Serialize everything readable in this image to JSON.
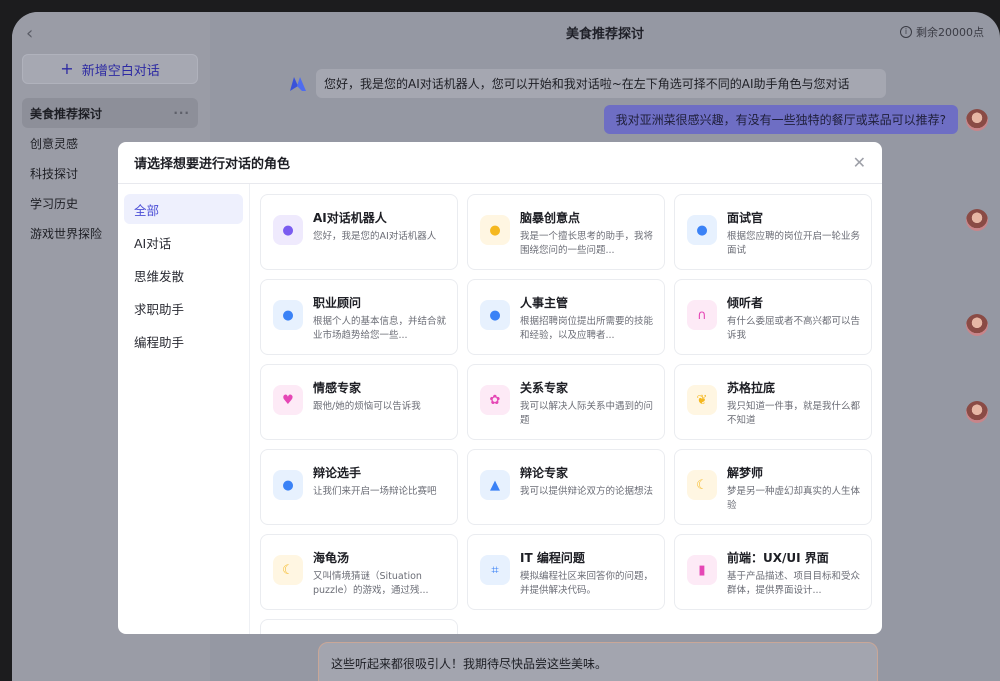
{
  "sidebar": {
    "new_chat_label": "新增空白对话",
    "items": [
      {
        "label": "美食推荐探讨",
        "active": true
      },
      {
        "label": "创意灵感"
      },
      {
        "label": "科技探讨"
      },
      {
        "label": "学习历史"
      },
      {
        "label": "游戏世界探险"
      }
    ]
  },
  "header": {
    "title": "美食推荐探讨",
    "points": "剩余20000点"
  },
  "chat": {
    "bot_message": "您好，我是您的AI对话机器人，您可以开始和我对话啦~在左下角选可择不同的AI助手角色与您对话",
    "user_message": "我对亚洲菜很感兴趣，有没有一些独特的餐厅或菜品可以推荐?",
    "input_text": "这些听起来都很吸引人！我期待尽快品尝这些美味。"
  },
  "modal": {
    "title": "请选择想要进行对话的角色",
    "categories": [
      "全部",
      "AI对话",
      "思维发散",
      "求职助手",
      "编程助手"
    ],
    "roles": [
      {
        "name": "AI对话机器人",
        "desc": "您好，我是您的AI对话机器人",
        "icon": "chat-bot-icon",
        "bg": "#efeafd",
        "fg": "#7a5cf0"
      },
      {
        "name": "脑暴创意点",
        "desc": "我是一个擅长思考的助手，我将围绕您问的一些问题...",
        "icon": "lightbulb-icon",
        "bg": "#fff6e2",
        "fg": "#f5b820"
      },
      {
        "name": "面试官",
        "desc": "根据您应聘的岗位开启一轮业务面试",
        "icon": "interviewer-icon",
        "bg": "#e7f1fe",
        "fg": "#3b82f6"
      },
      {
        "name": "职业顾问",
        "desc": "根据个人的基本信息，并结合就业市场趋势给您一些...",
        "icon": "person-icon",
        "bg": "#e7f1fe",
        "fg": "#3b82f6"
      },
      {
        "name": "人事主管",
        "desc": "根据招聘岗位提出所需要的技能和经验，以及应聘者...",
        "icon": "person-icon",
        "bg": "#e7f1fe",
        "fg": "#3b82f6"
      },
      {
        "name": "倾听者",
        "desc": "有什么委屈或者不高兴都可以告诉我",
        "icon": "headphones-icon",
        "bg": "#fdeaf6",
        "fg": "#e547b5"
      },
      {
        "name": "情感专家",
        "desc": "跟他/她的烦恼可以告诉我",
        "icon": "heart-icon",
        "bg": "#fdeaf6",
        "fg": "#e547b5"
      },
      {
        "name": "关系专家",
        "desc": "我可以解决人际关系中遇到的问题",
        "icon": "handshake-icon",
        "bg": "#fdeaf6",
        "fg": "#e547b5"
      },
      {
        "name": "苏格拉底",
        "desc": "我只知道一件事，就是我什么都不知道",
        "icon": "brain-icon",
        "bg": "#fff6e2",
        "fg": "#f5b820"
      },
      {
        "name": "辩论选手",
        "desc": "让我们来开启一场辩论比赛吧",
        "icon": "debater-icon",
        "bg": "#e7f1fe",
        "fg": "#3b82f6"
      },
      {
        "name": "辩论专家",
        "desc": "我可以提供辩论双方的论据想法",
        "icon": "graduation-cap-icon",
        "bg": "#e7f1fe",
        "fg": "#3b82f6"
      },
      {
        "name": "解梦师",
        "desc": "梦是另一种虚幻却真实的人生体验",
        "icon": "moon-icon",
        "bg": "#fff6e2",
        "fg": "#f5b820"
      },
      {
        "name": "海龟汤",
        "desc": "又叫情境猜谜（Situation puzzle）的游戏，通过残...",
        "icon": "moon-icon",
        "bg": "#fff6e2",
        "fg": "#f5b820"
      },
      {
        "name": "IT 编程问题",
        "desc": "模拟编程社区来回答你的问题，并提供解决代码。",
        "icon": "code-icon",
        "bg": "#e7f1fe",
        "fg": "#3b82f6"
      },
      {
        "name": "前端：UX/UI 界面",
        "desc": "基于产品描述、项目目标和受众群体，提供界面设计...",
        "icon": "phone-icon",
        "bg": "#fdeaf6",
        "fg": "#e547b5"
      }
    ]
  }
}
